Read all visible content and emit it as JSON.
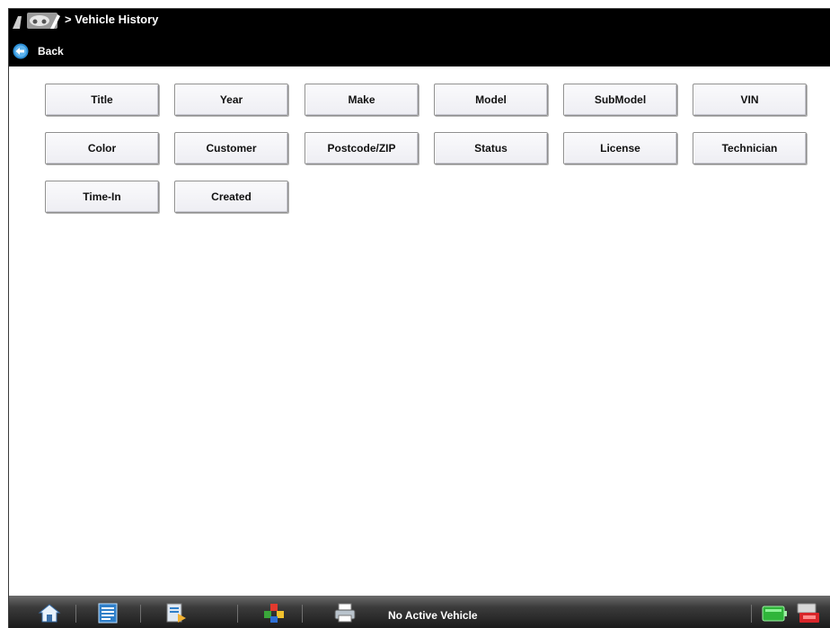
{
  "header": {
    "breadcrumb": "> Vehicle History",
    "back_label": "Back",
    "app_icon": "vehicle-icon"
  },
  "fields": [
    {
      "label": "Title"
    },
    {
      "label": "Year"
    },
    {
      "label": "Make"
    },
    {
      "label": "Model"
    },
    {
      "label": "SubModel"
    },
    {
      "label": "VIN"
    },
    {
      "label": "Color"
    },
    {
      "label": "Customer"
    },
    {
      "label": "Postcode/ZIP"
    },
    {
      "label": "Status"
    },
    {
      "label": "License"
    },
    {
      "label": "Technician"
    },
    {
      "label": "Time-In"
    },
    {
      "label": "Created"
    }
  ],
  "taskbar": {
    "status": "No Active Vehicle",
    "icons": [
      "home-icon",
      "data-icon",
      "shop-icon",
      "modules-icon",
      "print-icon",
      "battery-icon",
      "power-icon"
    ]
  },
  "colors": {
    "header_bg": "#000000",
    "back_accent": "#2d8fd6"
  }
}
